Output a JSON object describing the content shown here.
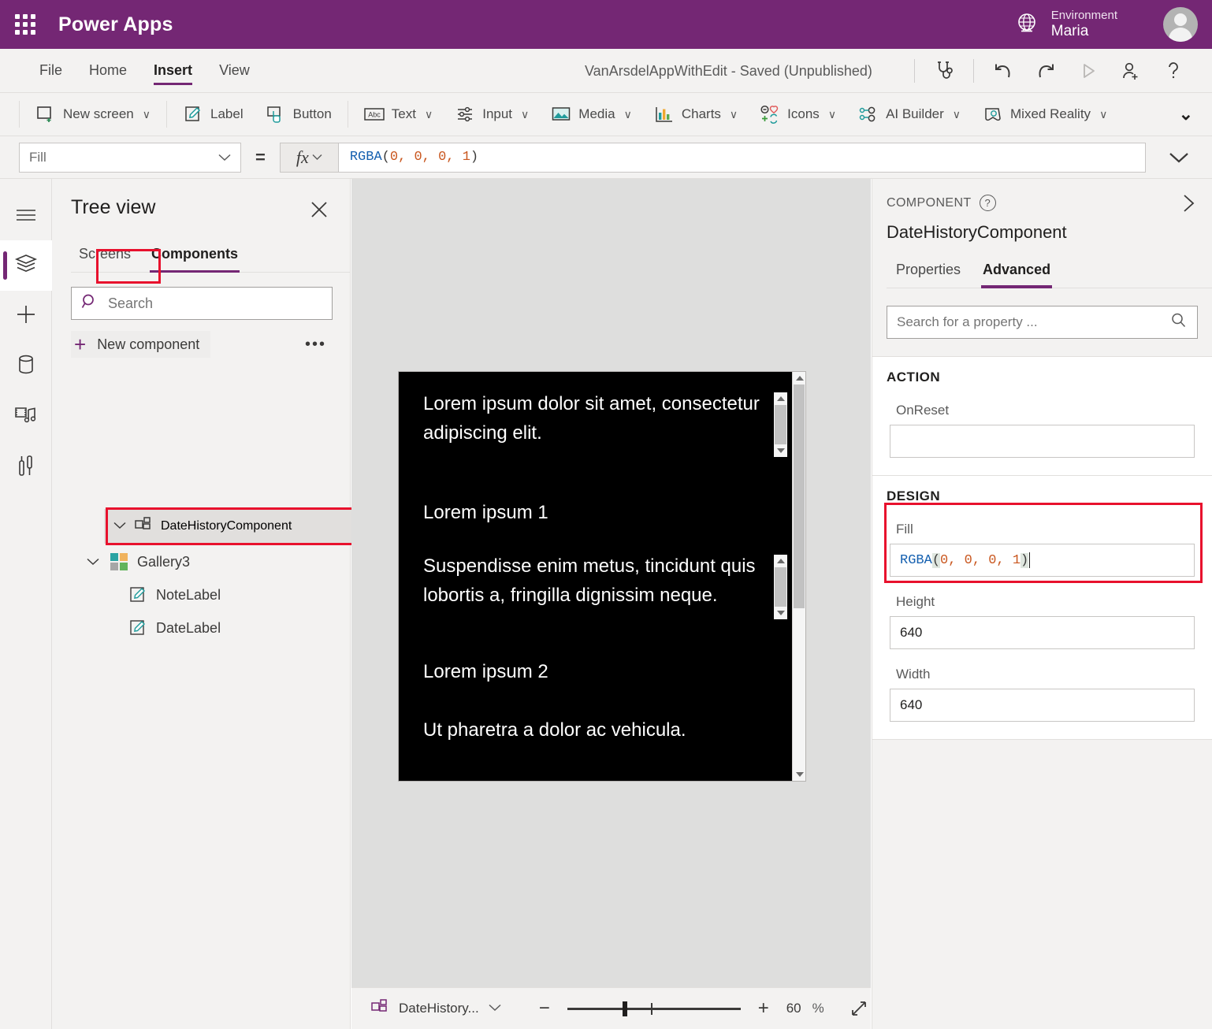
{
  "topbar": {
    "brand": "Power Apps",
    "env_label": "Environment",
    "env_name": "Maria",
    "waffle_icon": "waffle-icon",
    "globe_icon": "globe-icon",
    "avatar_icon": "user-avatar-icon"
  },
  "menubar": {
    "items": [
      {
        "label": "File",
        "active": false
      },
      {
        "label": "Home",
        "active": false
      },
      {
        "label": "Insert",
        "active": true
      },
      {
        "label": "View",
        "active": false
      }
    ],
    "app_title": "VanArsdelAppWithEdit - Saved (Unpublished)",
    "actions": [
      {
        "name": "app-checker-icon",
        "glyph": "stethoscope"
      },
      {
        "name": "undo-icon",
        "glyph": "undo"
      },
      {
        "name": "redo-icon",
        "glyph": "redo"
      },
      {
        "name": "preview-play-icon",
        "glyph": "play"
      },
      {
        "name": "share-user-icon",
        "glyph": "adduser"
      },
      {
        "name": "help-icon",
        "glyph": "question"
      }
    ]
  },
  "ribbon": {
    "items": [
      {
        "label": "New screen",
        "icon": "new-screen-icon",
        "caret": true
      },
      {
        "label": "Label",
        "icon": "label-icon",
        "caret": false
      },
      {
        "label": "Button",
        "icon": "button-icon",
        "caret": false
      },
      {
        "label": "Text",
        "icon": "text-icon",
        "caret": true
      },
      {
        "label": "Input",
        "icon": "input-icon",
        "caret": true
      },
      {
        "label": "Media",
        "icon": "media-icon",
        "caret": true
      },
      {
        "label": "Charts",
        "icon": "charts-icon",
        "caret": true
      },
      {
        "label": "Icons",
        "icon": "icons-icon",
        "caret": true
      },
      {
        "label": "AI Builder",
        "icon": "ai-builder-icon",
        "caret": true
      },
      {
        "label": "Mixed Reality",
        "icon": "mixed-reality-icon",
        "caret": true
      }
    ],
    "more_label": "⌄"
  },
  "formula_bar": {
    "property": "Fill",
    "equals": "=",
    "fx_label": "fx",
    "formula_fn": "RGBA",
    "formula_open": "(",
    "formula_args": "0, 0, 0, 1",
    "formula_close": ")",
    "formula_full": "RGBA(0, 0, 0, 1)"
  },
  "rail": {
    "items": [
      {
        "name": "hamburger-menu-icon",
        "selected": false
      },
      {
        "name": "tree-view-layers-icon",
        "selected": true
      },
      {
        "name": "insert-plus-icon",
        "selected": false
      },
      {
        "name": "data-sources-icon",
        "selected": false
      },
      {
        "name": "media-library-icon",
        "selected": false
      },
      {
        "name": "advanced-tools-icon",
        "selected": false
      }
    ]
  },
  "tree_view": {
    "title": "Tree view",
    "close_icon": "close-icon",
    "tabs": [
      {
        "label": "Screens",
        "active": false
      },
      {
        "label": "Components",
        "active": true
      }
    ],
    "search_placeholder": "Search",
    "search_value": "",
    "new_component_label": "New component",
    "new_component_more": "•••",
    "nodes": [
      {
        "label": "DateHistoryComponent",
        "icon": "component-icon",
        "depth": 0,
        "selected": true,
        "expanded": true,
        "more": "•••"
      },
      {
        "label": "Gallery3",
        "icon": "gallery-icon",
        "depth": 1,
        "selected": false,
        "expanded": true
      },
      {
        "label": "NoteLabel",
        "icon": "label-icon",
        "depth": 2,
        "selected": false
      },
      {
        "label": "DateLabel",
        "icon": "label-icon",
        "depth": 2,
        "selected": false
      }
    ]
  },
  "canvas": {
    "preview_background": "#000000",
    "items": [
      "Lorem ipsum dolor sit amet, consectetur adipiscing elit.",
      "Lorem ipsum 1",
      "Suspendisse enim metus, tincidunt quis lobortis a, fringilla dignissim neque.",
      "Lorem ipsum 2",
      "Ut pharetra a dolor ac vehicula."
    ]
  },
  "bottom_bar": {
    "component_label": "DateHistory...",
    "component_icon": "component-icon",
    "chevron": "chevron-down-icon",
    "zoom_out": "−",
    "zoom_in": "+",
    "zoom_value": "60",
    "zoom_unit": "%",
    "fullscreen_icon": "fit-screen-icon"
  },
  "properties": {
    "kicker": "COMPONENT",
    "help_icon": "help-circle-icon",
    "collapse_icon": "chevron-right-icon",
    "name": "DateHistoryComponent",
    "tabs": [
      {
        "label": "Properties",
        "active": false
      },
      {
        "label": "Advanced",
        "active": true
      }
    ],
    "search_placeholder": "Search for a property ...",
    "search_value": "",
    "search_icon": "search-icon",
    "sections": [
      {
        "title": "ACTION",
        "fields": [
          {
            "label": "OnReset",
            "value": "",
            "type": "formula"
          }
        ]
      },
      {
        "title": "DESIGN",
        "fields": [
          {
            "label": "Fill",
            "value": "RGBA(0, 0, 0, 1)",
            "type": "formula",
            "highlighted": true
          },
          {
            "label": "Height",
            "value": "640",
            "type": "number"
          },
          {
            "label": "Width",
            "value": "640",
            "type": "number"
          }
        ]
      }
    ]
  },
  "colors": {
    "brand_purple": "#742774",
    "highlight_red": "#e8112d",
    "chrome_gray": "#f3f2f1",
    "canvas_gray": "#dededd"
  }
}
